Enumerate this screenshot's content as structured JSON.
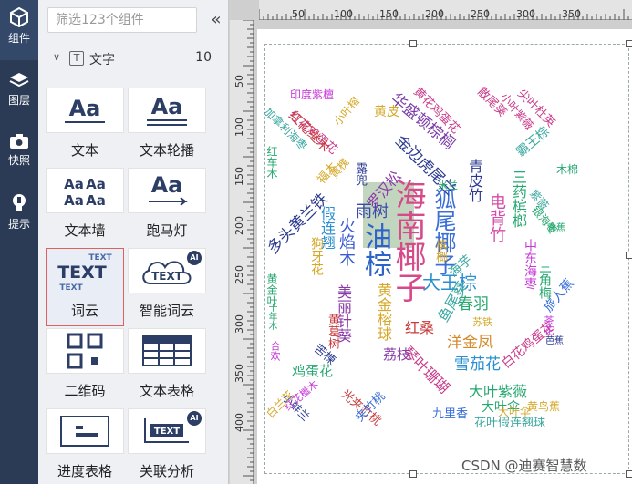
{
  "rail": {
    "items": [
      {
        "label": "组件",
        "icon": "cube-icon"
      },
      {
        "label": "图层",
        "icon": "layers-icon"
      },
      {
        "label": "快照",
        "icon": "camera-icon"
      },
      {
        "label": "提示",
        "icon": "lightbulb-icon"
      }
    ]
  },
  "panel": {
    "search_placeholder": "筛选123个组件",
    "collapse_glyph": "«",
    "section": {
      "title": "文字",
      "count": "10",
      "icon_glyph": "T",
      "chevron": "∨"
    },
    "tiles": [
      {
        "label": "文本",
        "art": "Aa"
      },
      {
        "label": "文本轮播",
        "art": "Aa"
      },
      {
        "label": "文本墙",
        "art": "Aa"
      },
      {
        "label": "跑马灯",
        "art": "Aa"
      },
      {
        "label": "词云",
        "art": "TEXT"
      },
      {
        "label": "智能词云",
        "art": "TEXT",
        "badge": "AI"
      },
      {
        "label": "二维码",
        "art": ""
      },
      {
        "label": "文本表格",
        "art": ""
      },
      {
        "label": "进度表格",
        "art": ""
      },
      {
        "label": "关联分析",
        "art": "TEXT",
        "badge": "AI"
      }
    ]
  },
  "ruler": {
    "top_ticks": [
      "50",
      "100",
      "150",
      "200",
      "250",
      "300",
      "350"
    ],
    "left_ticks": [
      "50",
      "100",
      "150",
      "200",
      "250",
      "300",
      "350",
      "400"
    ]
  },
  "wordcloud": {
    "words": [
      "海南椰子",
      "狐尾椰子",
      "油棕",
      "大王棕",
      "电背竹",
      "火焰木",
      "雨树",
      "多头黄兰铁",
      "金边虎尾兰",
      "华盛顿棕榈",
      "三药槟榔",
      "罗汉松",
      "春羽",
      "洋金凤",
      "雪茄花",
      "大叶紫薇",
      "大叶伞",
      "花叶假连翘球",
      "九里香",
      "美丽针葵",
      "红桑",
      "黄金榕球",
      "三角梅",
      "鱼尾葵",
      "假连翘",
      "琴叶珊瑚",
      "荔枝",
      "鸡蛋花",
      "狗牙花",
      "红花鸡蛋花",
      "白花鸡蛋花",
      "印度紫檀",
      "小叶榕",
      "黄皮",
      "霸王棕",
      "尖叶杜英",
      "小叶紫薇",
      "散尾葵",
      "红花继木",
      "青皮竹",
      "中东海枣",
      "旅人蕉",
      "黄鸟蕉",
      "紫薇",
      "小蚌兰",
      "光夹竹桃",
      "白兰花",
      "红车木",
      "米兰",
      "黄槐",
      "木棉",
      "芭蕉",
      "福木",
      "露兜",
      "黄花鸡蛋花",
      "夹竹桃",
      "苏铁",
      "千年木",
      "大叶伞",
      "红花檵木",
      "加拿利海枣",
      "黄金叶",
      "合欢",
      "苦楝",
      "银海枣",
      "海芋",
      "槟榔",
      "香蕉",
      "茶花",
      "黄葛树"
    ]
  },
  "watermark": "CSDN @迪赛智慧数"
}
